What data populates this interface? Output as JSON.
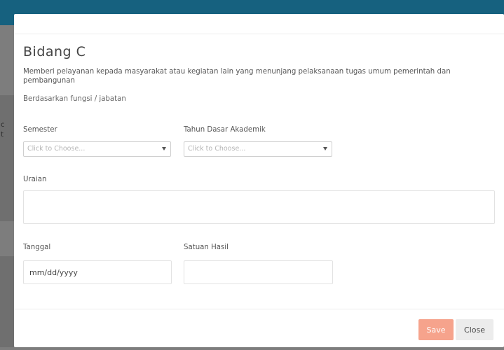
{
  "background": {
    "bg_text_1": "c",
    "bg_text_2": "t"
  },
  "modal": {
    "title": "Bidang C",
    "description": "Memberi pelayanan kepada masyarakat atau kegiatan lain yang menunjang pelaksanaan tugas umum pemerintah dan pembangunan",
    "subdescription": "Berdasarkan fungsi / jabatan",
    "fields": {
      "semester": {
        "label": "Semester",
        "placeholder": "Click to Choose..."
      },
      "tahun": {
        "label": "Tahun Dasar Akademik",
        "placeholder": "Click to Choose..."
      },
      "uraian": {
        "label": "Uraian",
        "value": ""
      },
      "tanggal": {
        "label": "Tanggal",
        "value": "mm/dd/yyyy"
      },
      "satuan": {
        "label": "Satuan Hasil",
        "value": ""
      }
    },
    "buttons": {
      "save": "Save",
      "close": "Close"
    }
  },
  "colors": {
    "topbar": "#16617f",
    "save_button": "#f6a38c",
    "close_button": "#ececec"
  }
}
